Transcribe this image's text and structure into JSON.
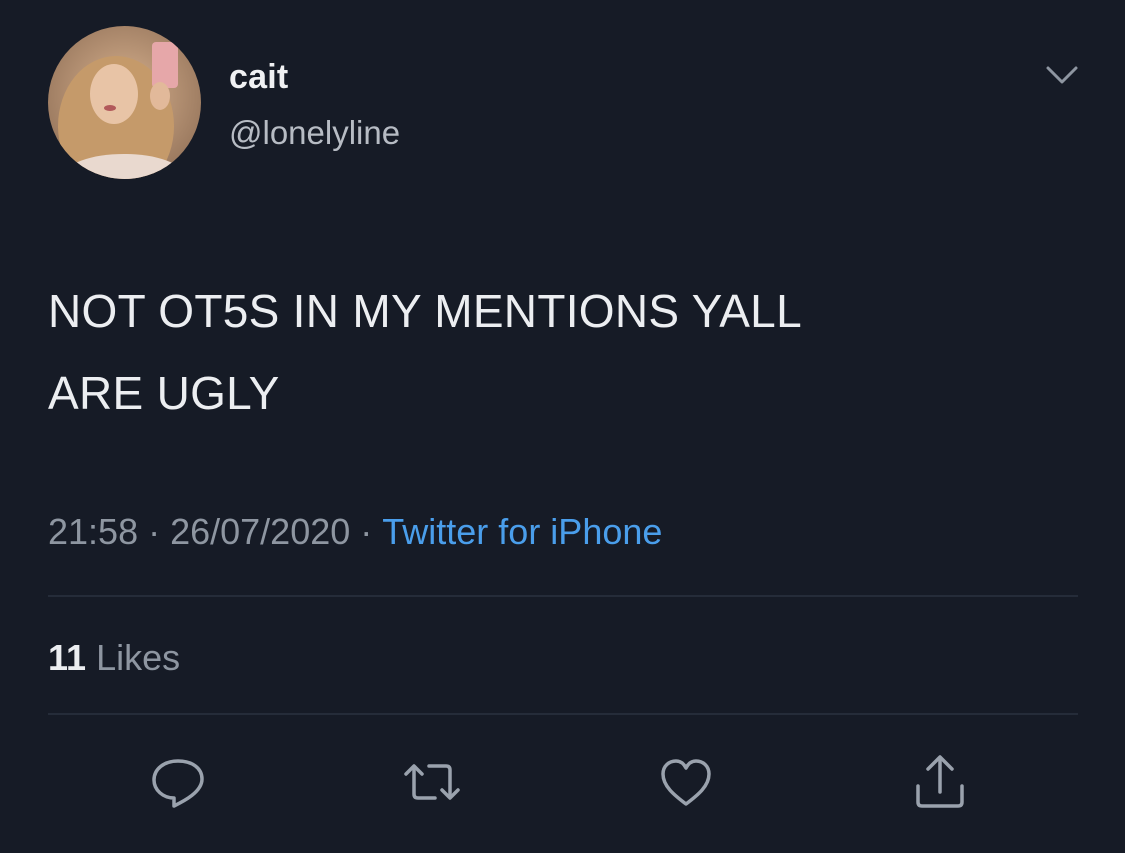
{
  "user": {
    "display_name": "cait",
    "handle": "@lonelyline"
  },
  "tweet": {
    "text_line1": "NOT OT5S IN MY MENTIONS YALL",
    "text_line2": "ARE UGLY"
  },
  "meta": {
    "time": "21:58",
    "separator": "·",
    "date": "26/07/2020",
    "source": "Twitter for iPhone"
  },
  "stats": {
    "likes_count": "11",
    "likes_label": "Likes"
  },
  "icons": {
    "menu": "chevron-down-icon",
    "reply": "reply-icon",
    "retweet": "retweet-icon",
    "like": "heart-icon",
    "share": "share-icon"
  },
  "colors": {
    "background": "#161b26",
    "link": "#4a9eeb",
    "muted": "#8e96a1"
  }
}
